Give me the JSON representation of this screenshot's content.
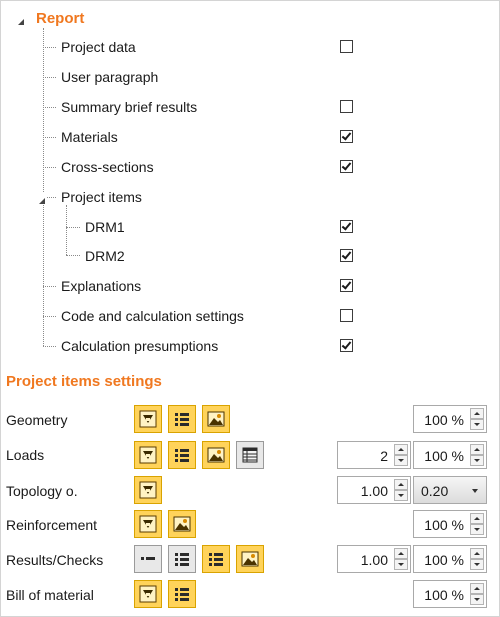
{
  "tree": {
    "root_label": "Report",
    "items": [
      {
        "label": "Project data",
        "checked": false
      },
      {
        "label": "User paragraph",
        "checked": null
      },
      {
        "label": "Summary brief results",
        "checked": false
      },
      {
        "label": "Materials",
        "checked": true
      },
      {
        "label": "Cross-sections",
        "checked": true
      },
      {
        "label": "Project items",
        "checked": null
      },
      {
        "label": "DRM1",
        "checked": true
      },
      {
        "label": "DRM2",
        "checked": true
      },
      {
        "label": "Explanations",
        "checked": true
      },
      {
        "label": "Code and calculation settings",
        "checked": false
      },
      {
        "label": "Calculation presumptions",
        "checked": true
      }
    ]
  },
  "settings": {
    "title": "Project items settings",
    "rows": [
      {
        "label": "Geometry",
        "percent": "100 %"
      },
      {
        "label": "Loads",
        "count": "2",
        "percent": "100 %"
      },
      {
        "label": "Topology o.",
        "value": "1.00",
        "dropdown": "0.20"
      },
      {
        "label": "Reinforcement",
        "percent": "100 %"
      },
      {
        "label": "Results/Checks",
        "value": "1.00",
        "percent": "100 %"
      },
      {
        "label": "Bill of material",
        "percent": "100 %"
      }
    ]
  },
  "icons": {
    "structure": "structure-view-icon",
    "list": "list-icon",
    "picture": "picture-icon",
    "table": "table-icon",
    "brief": "brief-list-icon"
  },
  "colors": {
    "accent": "#f07820",
    "button_on": "#ffd35a",
    "button_off": "#e8e8e8"
  }
}
